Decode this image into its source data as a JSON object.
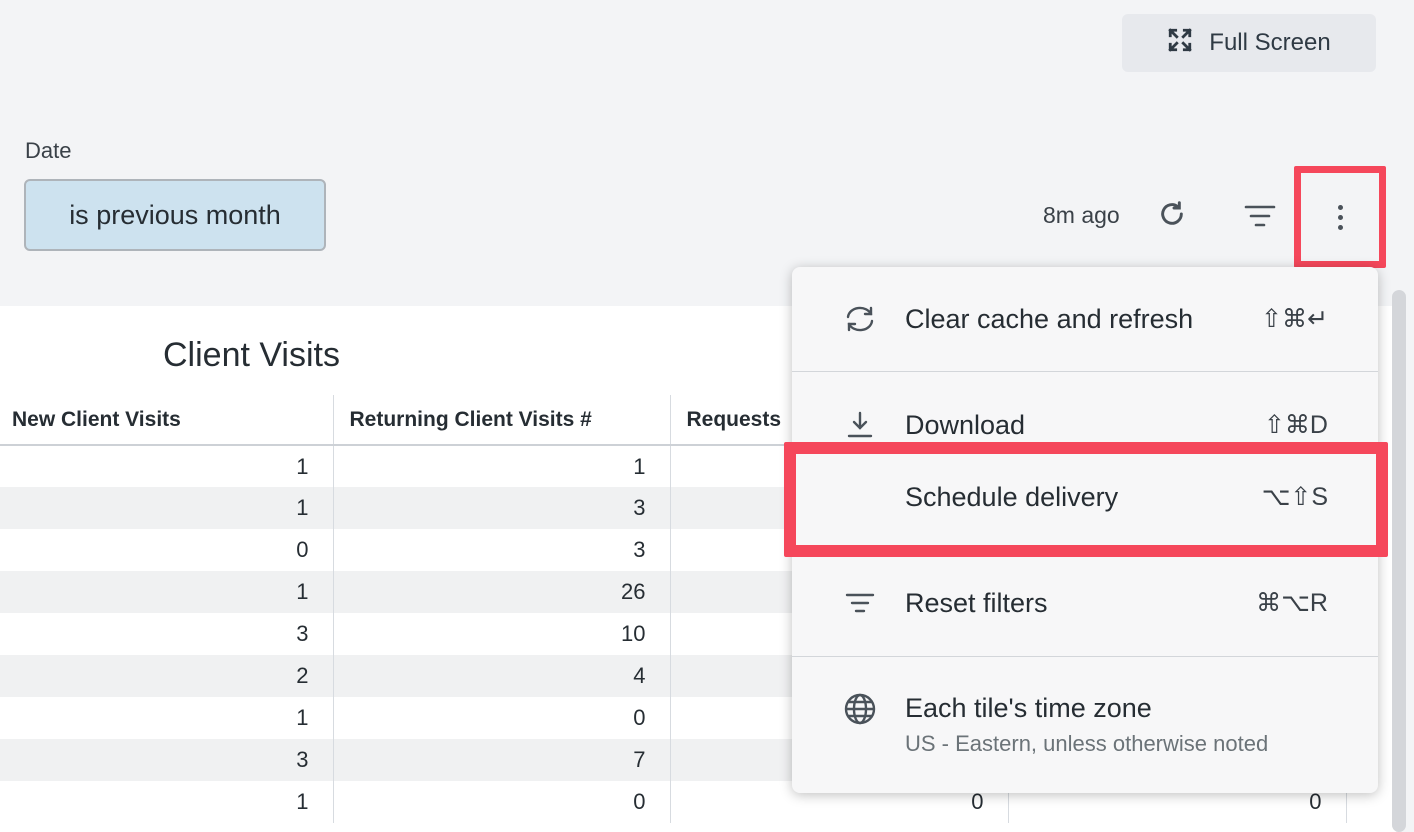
{
  "header": {
    "full_screen_label": "Full Screen"
  },
  "filters": {
    "date_label": "Date",
    "date_value": "is previous month"
  },
  "toolbar": {
    "updated_text": "8m ago"
  },
  "tile": {
    "title": "Client Visits",
    "columns": [
      "New Client Visits",
      "Returning Client Visits #",
      "Requests"
    ],
    "rows": [
      [
        "1",
        "1",
        "",
        ""
      ],
      [
        "1",
        "3",
        "",
        ""
      ],
      [
        "0",
        "3",
        "",
        ""
      ],
      [
        "1",
        "26",
        "",
        ""
      ],
      [
        "3",
        "10",
        "",
        ""
      ],
      [
        "2",
        "4",
        "",
        ""
      ],
      [
        "1",
        "0",
        "",
        ""
      ],
      [
        "3",
        "7",
        "",
        ""
      ],
      [
        "1",
        "0",
        "0",
        "0"
      ]
    ]
  },
  "menu": {
    "items": [
      {
        "label": "Clear cache and refresh",
        "shortcut": "⇧⌘↵",
        "icon": "sync-icon"
      },
      {
        "label": "Download",
        "shortcut": "⇧⌘D",
        "icon": "download-icon"
      },
      {
        "label": "Schedule delivery",
        "shortcut": "⌥⇧S",
        "icon": ""
      },
      {
        "label": "Reset filters",
        "shortcut": "⌘⌥R",
        "icon": "filter-lines-icon"
      },
      {
        "label": "Each tile's time zone",
        "sublabel": "US - Eastern, unless otherwise noted",
        "icon": "globe-icon"
      }
    ]
  },
  "colors": {
    "highlight": "#f5475b",
    "filter_chip": "#cde2ef"
  }
}
